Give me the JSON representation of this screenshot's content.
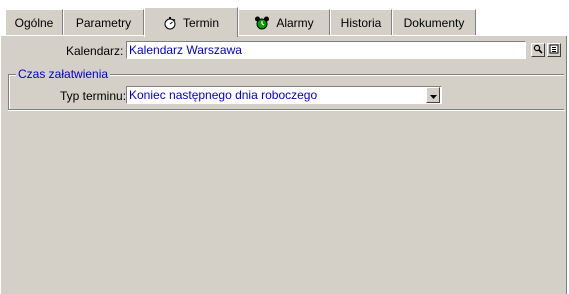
{
  "tabs": [
    {
      "id": "ogolne",
      "label": "Ogólne",
      "icon": null,
      "active": false
    },
    {
      "id": "parametry",
      "label": "Parametry",
      "icon": null,
      "active": false
    },
    {
      "id": "termin",
      "label": "Termin",
      "icon": "stopwatch-icon",
      "active": true
    },
    {
      "id": "alarmy",
      "label": "Alarmy",
      "icon": "alarm-clock-icon",
      "active": false
    },
    {
      "id": "historia",
      "label": "Historia",
      "icon": null,
      "active": false
    },
    {
      "id": "dokumenty",
      "label": "Dokumenty",
      "icon": null,
      "active": false
    }
  ],
  "calendar": {
    "label": "Kalendarz:",
    "value": "Kalendarz Warszawa"
  },
  "group": {
    "title": "Czas załatwienia",
    "term_type_label": "Typ terminu:",
    "term_type_value": "Koniec następnego dnia roboczego"
  },
  "colors": {
    "panel": "#d4d0c8",
    "value_text": "#0000cc"
  }
}
